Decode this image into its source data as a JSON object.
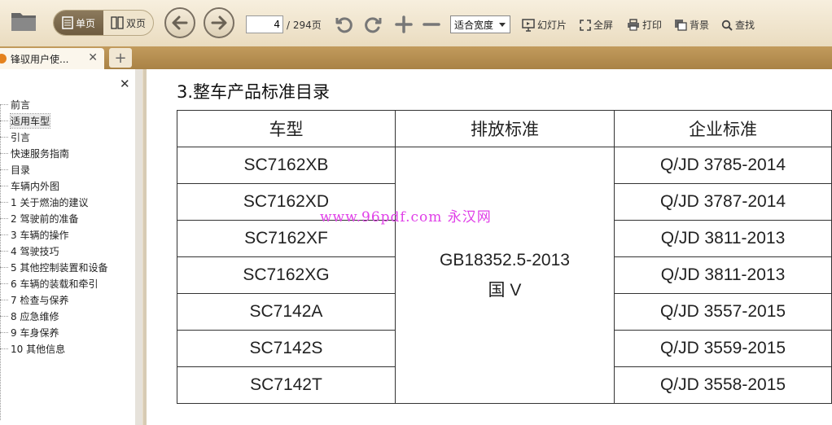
{
  "toolbar": {
    "single_page": "单页",
    "double_page": "双页",
    "current_page": "4",
    "total_pages": "/ 294页",
    "zoom_value": "适合宽度",
    "slideshow": "幻灯片",
    "fullscreen": "全屏",
    "print": "打印",
    "background": "背景",
    "find": "查找"
  },
  "tabs": [
    {
      "label": "锋驭用户使..."
    }
  ],
  "sidebar": {
    "items": [
      {
        "label": "前言"
      },
      {
        "label": "适用车型"
      },
      {
        "label": "引言"
      },
      {
        "label": "快速服务指南"
      },
      {
        "label": "目录"
      },
      {
        "label": "车辆内外图"
      },
      {
        "label": "1 关于燃油的建议"
      },
      {
        "label": "2 驾驶前的准备"
      },
      {
        "label": "3 车辆的操作"
      },
      {
        "label": "4 驾驶技巧"
      },
      {
        "label": "5 其他控制装置和设备"
      },
      {
        "label": "6 车辆的装载和牵引"
      },
      {
        "label": "7 检查与保养"
      },
      {
        "label": "8 应急维修"
      },
      {
        "label": "9 车身保养"
      },
      {
        "label": "10 其他信息"
      }
    ]
  },
  "document": {
    "title": "3.整车产品标准目录",
    "headers": [
      "车型",
      "排放标准",
      "企业标准"
    ],
    "emission_line1": "GB18352.5-2013",
    "emission_line2": "国 V",
    "rows": [
      {
        "model": "SC7162XB",
        "standard": "Q/JD 3785-2014"
      },
      {
        "model": "SC7162XD",
        "standard": "Q/JD 3787-2014"
      },
      {
        "model": "SC7162XF",
        "standard": "Q/JD 3811-2013"
      },
      {
        "model": "SC7162XG",
        "standard": "Q/JD 3811-2013"
      },
      {
        "model": "SC7142A",
        "standard": "Q/JD 3557-2015"
      },
      {
        "model": "SC7142S",
        "standard": "Q/JD 3559-2015"
      },
      {
        "model": "SC7142T",
        "standard": "Q/JD 3558-2015"
      }
    ],
    "watermark": "www.96pdf.com 永汉网"
  }
}
